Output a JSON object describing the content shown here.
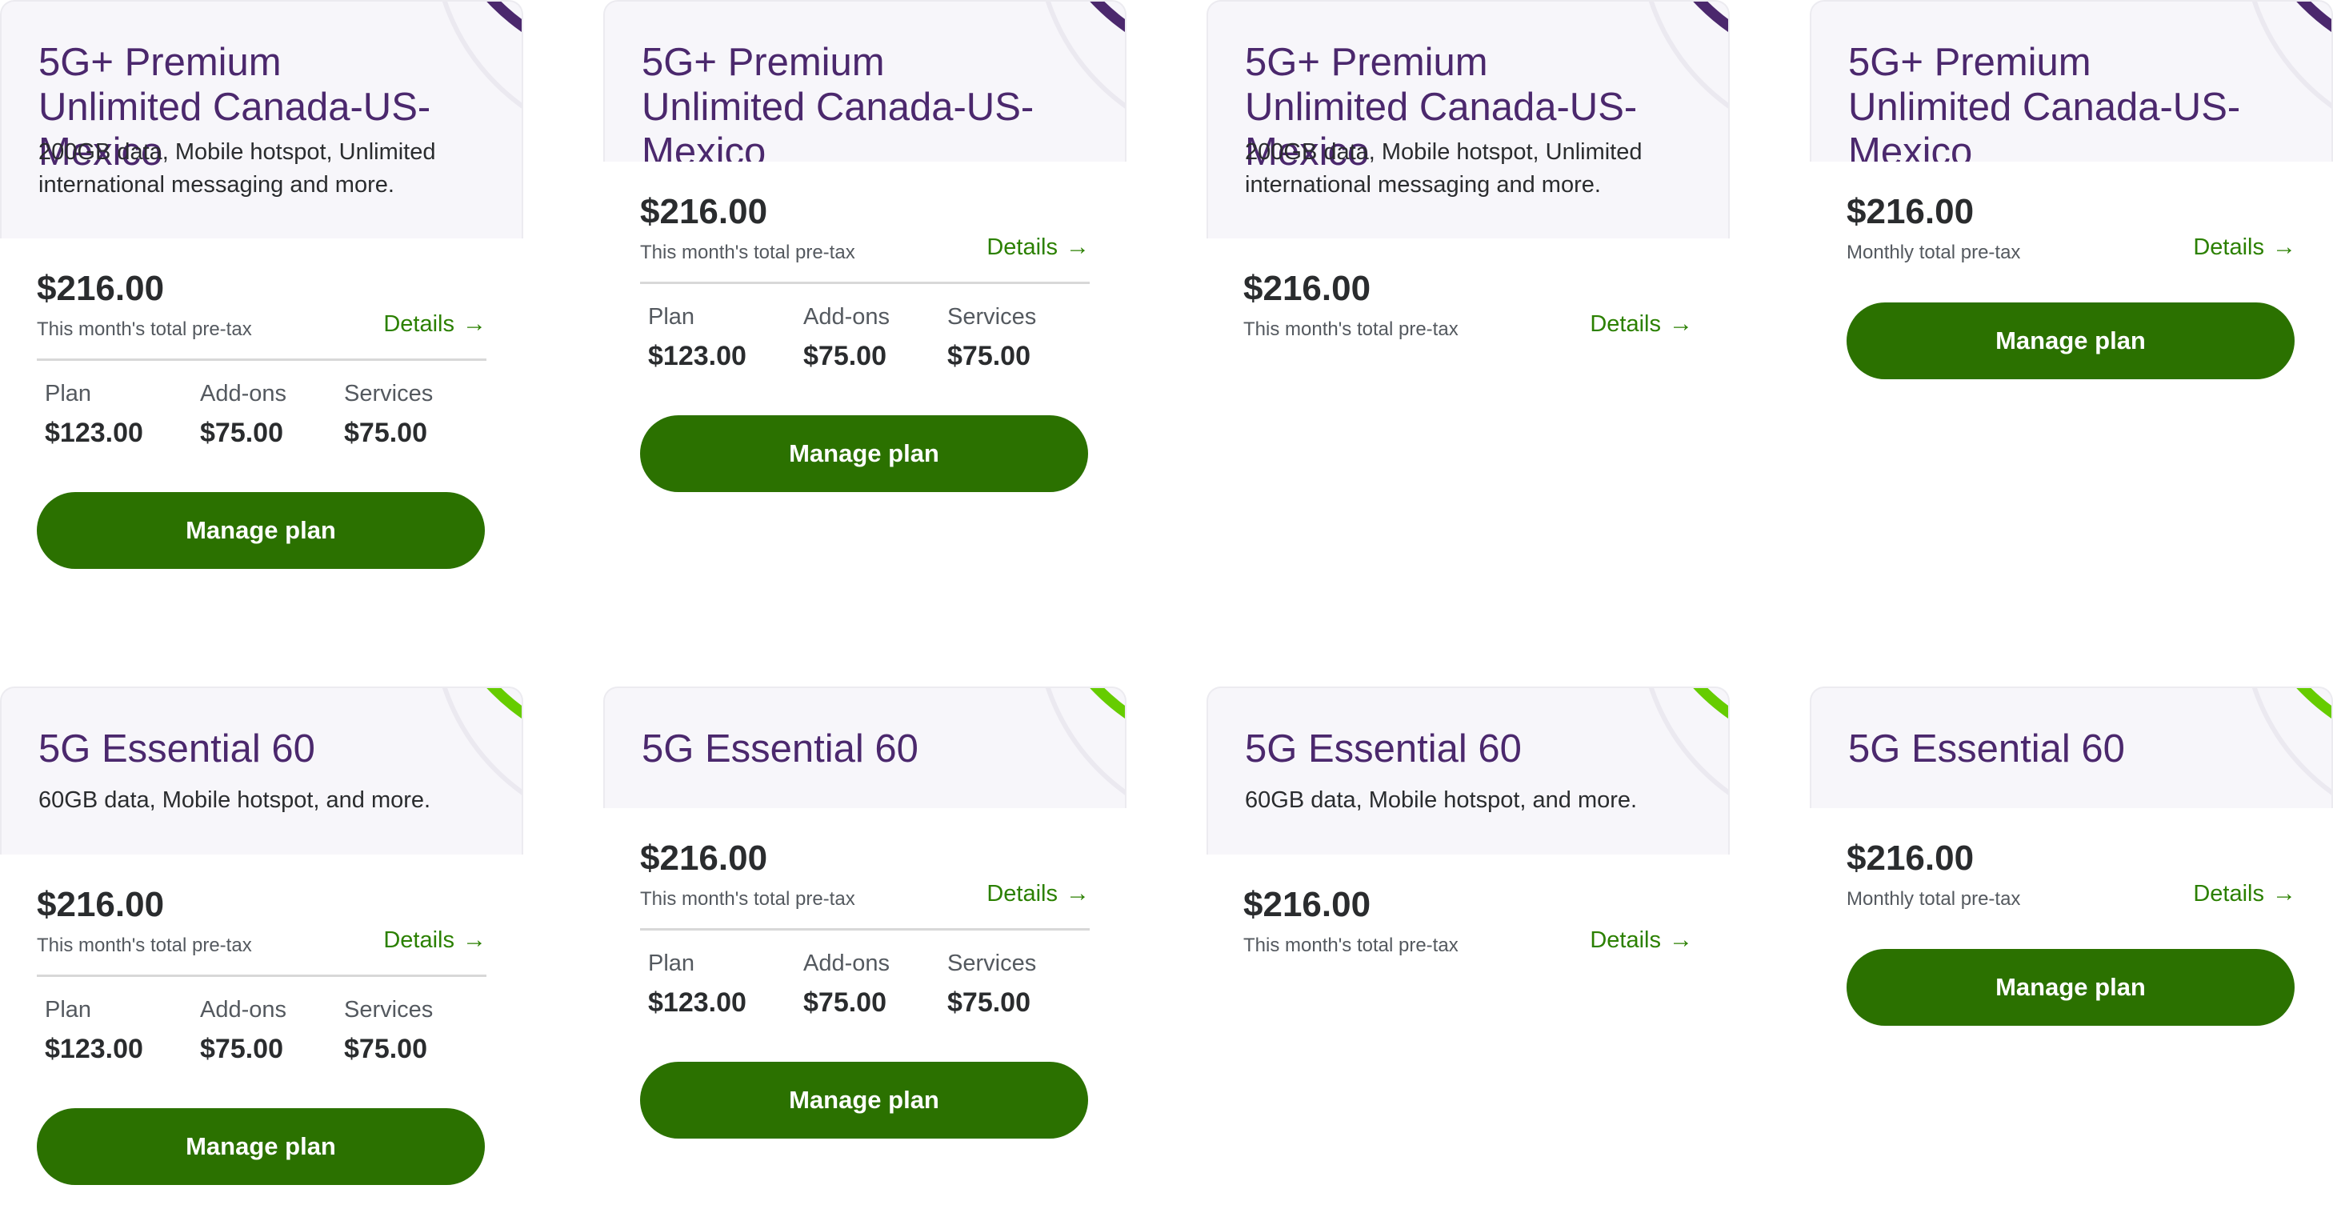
{
  "colors": {
    "title_purple": "#4b286d",
    "accent_magenta": "#c2307e",
    "accent_green_light": "#66cc00",
    "accent_green_dark": "#2b8000",
    "button_green": "#2b7100",
    "header_bg": "#f7f6fa"
  },
  "premium": {
    "title": "5G+ Premium Unlimited Canada-US-Mexico",
    "description": "200GB data, Mobile hotspot, Unlimited international messaging and more."
  },
  "essential": {
    "title": "5G Essential 60",
    "description": "60GB data, Mobile hotspot, and more."
  },
  "pricing": {
    "total": "$216.00",
    "this_month_label": "This month's total pre-tax",
    "monthly_label": "Monthly total pre-tax",
    "details_label": "Details",
    "details_icon": "arrow-right-icon",
    "arrow_glyph": "→"
  },
  "breakdown": {
    "plan_label": "Plan",
    "plan_value": "$123.00",
    "addons_label": "Add-ons",
    "addons_value": "$75.00",
    "services_label": "Services",
    "services_value": "$75.00"
  },
  "manage_label": "Manage plan"
}
